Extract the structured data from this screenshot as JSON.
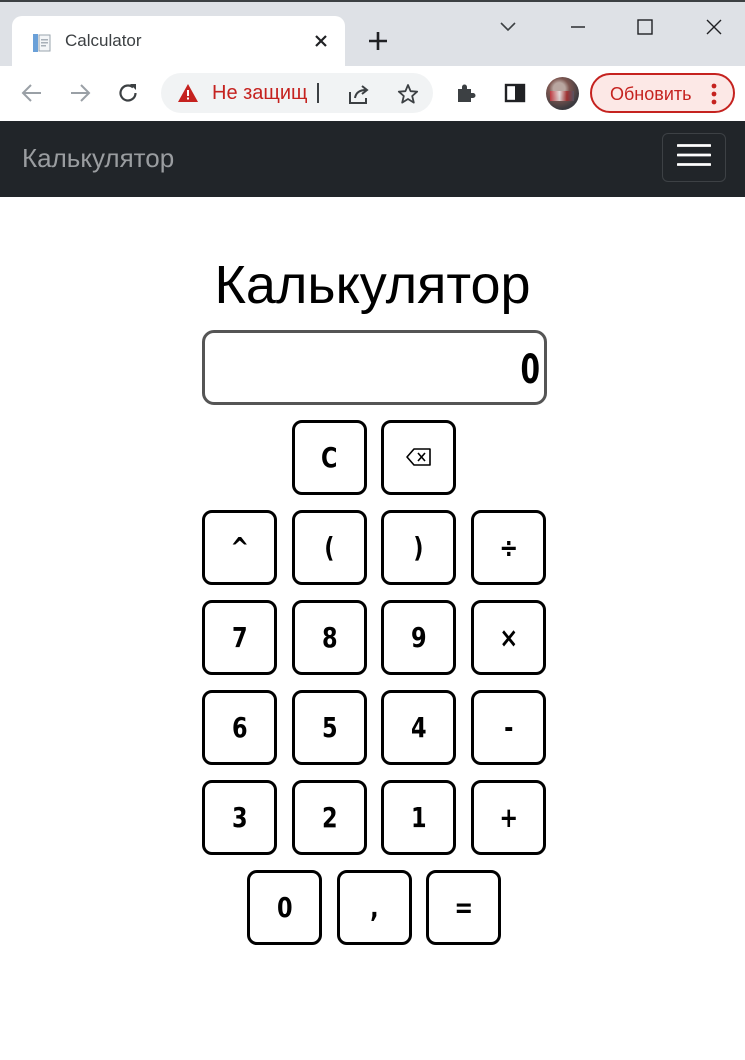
{
  "browser": {
    "tab_title": "Calculator",
    "security_warning": "Не защищ",
    "update_button": "Обновить"
  },
  "navbar": {
    "brand": "Калькулятор"
  },
  "calculator": {
    "heading": "Калькулятор",
    "display_value": "0",
    "keys": {
      "clear": "C",
      "backspace_icon": "backspace-icon",
      "power": "^",
      "open_paren": "(",
      "close_paren": ")",
      "divide": "÷",
      "seven": "7",
      "eight": "8",
      "nine": "9",
      "multiply": "×",
      "six": "6",
      "five": "5",
      "four": "4",
      "minus": "-",
      "three": "3",
      "two": "2",
      "one": "1",
      "plus": "+",
      "zero": "0",
      "comma": ",",
      "equals": "="
    }
  }
}
